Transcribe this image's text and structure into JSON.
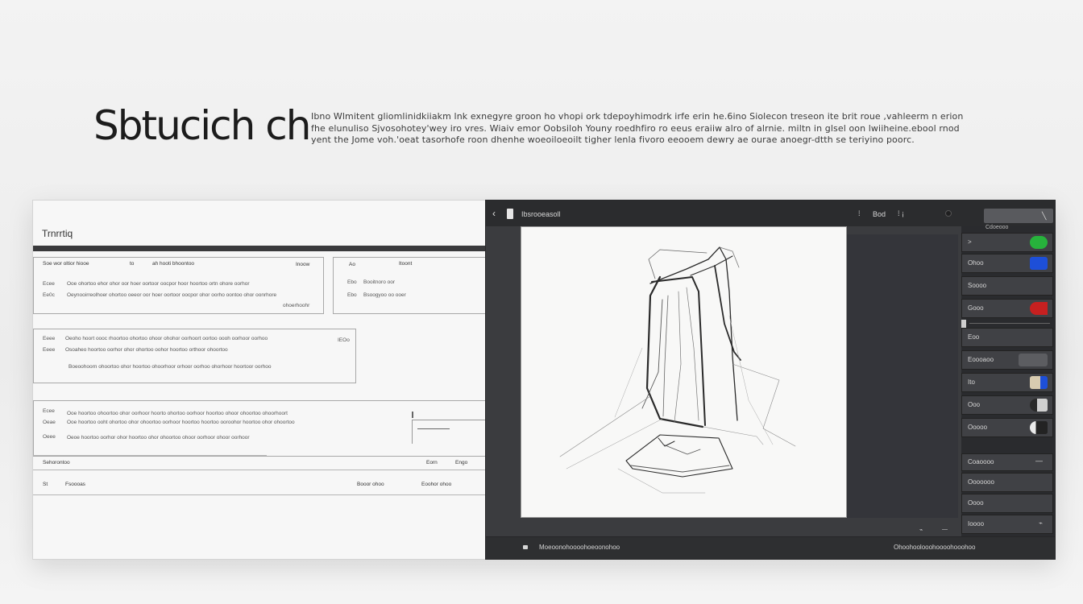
{
  "header": {
    "title": "Sbtucich ch",
    "description": "Ibno Wlmitent gliomlinidkiiakm lnk exnegyre groon ho vhopi ork tdepoyhimodrk irfe erin he.6ino Siolecon  treseon ite brit roue ,vahleerm n erion fhe elunuliso Sjvosohotey'wey iro vres. Wiaiv emor Oobsiloh Youny roedhfiro ro eeus eraiiw alro of alrnie. miltn in glsel oon lwiiheine.ebool rnod yent the Jome voh.'oeat tasorhofe roon dhenhe woeoiloeoilt tigher lenla fivoro eeooem dewry ae ourae anoegr-dtth se teriyino poorc."
  },
  "document": {
    "title": "Trnrrtiq",
    "box1": {
      "header_left": "Soe    wor oltior hiooe",
      "header_num": "to",
      "header_mid": "ah  hooti bhoontoo",
      "header_right": "Inoow",
      "row1_label": "Ecee",
      "row1_text": "Ooe ohortoo ehor ohor oor hoer oortoor oocpor hoor hoortoo ortn ohore oorhor",
      "row2_label": "Ee0c",
      "row2_text": "Oeynooirreolhoer ohortoo oeeor oor hoer oortoor oocpor ohor oorho oontoo ohor oonrhore",
      "row2_tail": "ohoerhoohr"
    },
    "box2": {
      "header_left": "Ao",
      "header_right": "Itoont",
      "row1_label": "Ebo",
      "row1_text": "Booitnoro oor",
      "row2_label": "Ebo",
      "row2_text": "Bsoogyoo oo ooer"
    },
    "box3": {
      "row1_label": "Eeee",
      "row1_text": "Oeoho hoort oooc rhoortoo ohortoo ohoor ohohor oorhoort oortoo oooh oorhoor oorhoo",
      "row2_label": "Eeee",
      "row2_text": "Osoaheo hoortoo oorhor ohor ohortoo oohor hoortoo orthoor ohoortoo",
      "row3_text": "Boeoohoorn ohoortoo ohor hoortoo ohoorhoor orhoor oorhoo ohorhoor hoortoor oorhoo",
      "tag": "IEOo"
    },
    "box4": {
      "row1_label": "Ecee",
      "row1_text": "Ooe hoortoo ohoortoo ohor oorhoor hoorto ohortoo oorhoor hoortoo ohoor ohoortoo ohoorhoort",
      "row2_label": "Oeae",
      "row2_text": "Ooe hoortoo ooht ohortoo ohor ohoortoo oorhoor hoortoo hoortoo ooroohor hoortoo ohor ohoortoo",
      "row3_label": "Oeee",
      "row3_text": "Oeoe hoortoo oorhor ohor hoortoo ohor ohoortoo ohoor oorhoor ohoor oorhoor"
    },
    "footer1": {
      "left": "Sehorontoo",
      "mid": "Eorn",
      "right": "Engo"
    },
    "footer2": {
      "num": "St",
      "label": "Fsoooas",
      "mid": "Booor ohoo",
      "right": "Eoohor ohoo"
    }
  },
  "editor": {
    "topbar_title": "Ibsrooeasoll",
    "topbar_mid": "Bod",
    "bottombar_left": "Moeoonohoooohoeoonohoo",
    "bottombar_right": "Ohoohoolooohoooohooohoo",
    "panel": {
      "header": "Cdoeooo",
      "rows": [
        {
          "label": ">",
          "swatch": "#27b23c"
        },
        {
          "label": "Ohoo",
          "swatch": "#1d4fd8"
        },
        {
          "label": "Soooo",
          "swatch": ""
        },
        {
          "label": "Gooo",
          "swatch": "#c62020"
        },
        {
          "label": "Eoo",
          "swatch": ""
        },
        {
          "label": "Eoooaoo",
          "swatch": "#6a6a6a"
        },
        {
          "label": "Ito",
          "swatch": "#c8b89a"
        },
        {
          "label": "Ooo",
          "swatch": "#bfbfbf"
        },
        {
          "label": "Ooooo",
          "swatch": "#e8e8e8"
        }
      ],
      "lower_header": "Coaoooo",
      "lower_rows": [
        "Ooooooo",
        "Oooo",
        "Ioooo"
      ]
    }
  }
}
